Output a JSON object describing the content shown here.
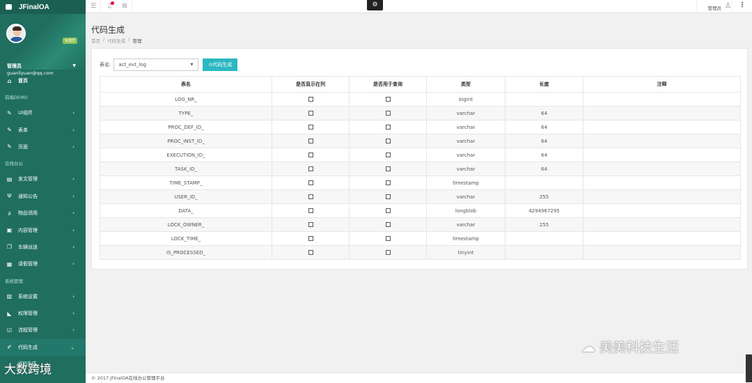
{
  "app": {
    "brand": "JFinalOA"
  },
  "profile": {
    "badge": "管理员",
    "name": "管理员",
    "email": "guanliyuan@qq.com"
  },
  "sidebar": {
    "home": "首页",
    "sections": [
      {
        "title": "前端DEMO",
        "items": [
          {
            "label": "UI组件",
            "icon": "pencil-icon"
          },
          {
            "label": "表单",
            "icon": "pencil-icon"
          },
          {
            "label": "页面",
            "icon": "pencil-icon"
          }
        ]
      },
      {
        "title": "在线办公",
        "items": [
          {
            "label": "发文管理",
            "icon": "calendar-icon"
          },
          {
            "label": "通知公告",
            "icon": "antenna-icon"
          },
          {
            "label": "物品领用",
            "icon": "link-icon"
          },
          {
            "label": "内容管理",
            "icon": "file-icon"
          },
          {
            "label": "车辆派送",
            "icon": "window-icon"
          },
          {
            "label": "请假管理",
            "icon": "document-icon"
          }
        ]
      },
      {
        "title": "系统管理",
        "items": [
          {
            "label": "系统设置",
            "icon": "save-icon"
          },
          {
            "label": "权限管理",
            "icon": "chart-icon"
          },
          {
            "label": "流程管理",
            "icon": "edit-icon"
          },
          {
            "label": "代码生成",
            "icon": "wrench-icon"
          }
        ]
      }
    ],
    "sub_item": "代码生成"
  },
  "topbar": {
    "user": "管理员"
  },
  "page": {
    "title": "代码生成",
    "breadcrumb": [
      "首页",
      "代码生成",
      "管理"
    ]
  },
  "form": {
    "table_label": "表名:",
    "table_value": "act_evt_log",
    "generate_button": "⊙代码生成"
  },
  "table": {
    "headers": [
      "表名",
      "是否显示在列",
      "是否用于查询",
      "类型",
      "长度",
      "注释"
    ],
    "rows": [
      {
        "name": "LOG_NR_",
        "type": "bigint",
        "length": ""
      },
      {
        "name": "TYPE_",
        "type": "varchar",
        "length": "64"
      },
      {
        "name": "PROC_DEF_ID_",
        "type": "varchar",
        "length": "64"
      },
      {
        "name": "PROC_INST_ID_",
        "type": "varchar",
        "length": "64"
      },
      {
        "name": "EXECUTION_ID_",
        "type": "varchar",
        "length": "64"
      },
      {
        "name": "TASK_ID_",
        "type": "varchar",
        "length": "64"
      },
      {
        "name": "TIME_STAMP_",
        "type": "timestamp",
        "length": ""
      },
      {
        "name": "USER_ID_",
        "type": "varchar",
        "length": "255"
      },
      {
        "name": "DATA_",
        "type": "longblob",
        "length": "4294967295"
      },
      {
        "name": "LOCK_OWNER_",
        "type": "varchar",
        "length": "255"
      },
      {
        "name": "LOCK_TIME_",
        "type": "timestamp",
        "length": ""
      },
      {
        "name": "IS_PROCESSED_",
        "type": "tinyint",
        "length": ""
      }
    ]
  },
  "footer": {
    "text": "© 2017 JFinalOA在线办公管理平台"
  },
  "watermarks": {
    "right": "美美科技生活",
    "left": "大数跨境"
  },
  "colors": {
    "sidebar": "#1f6e60",
    "accent": "#2cb7c2",
    "badge": "#8dc153"
  }
}
